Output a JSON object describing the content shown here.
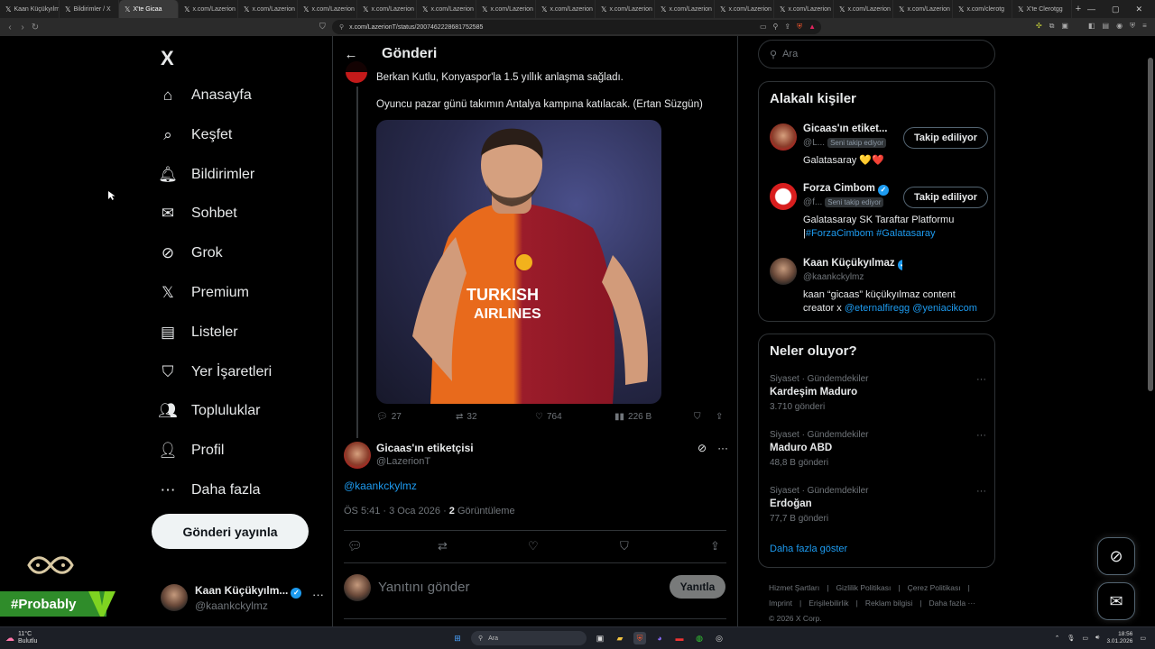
{
  "browser": {
    "tabs": [
      {
        "title": "Kaan Küçükyılm",
        "active": false
      },
      {
        "title": "Bildirimler / X",
        "active": false
      },
      {
        "title": "X'te Gicaa",
        "active": true
      },
      {
        "title": "x.com/Lazerion",
        "active": false
      },
      {
        "title": "x.com/Lazerion",
        "active": false
      },
      {
        "title": "x.com/Lazerion",
        "active": false
      },
      {
        "title": "x.com/Lazerion",
        "active": false
      },
      {
        "title": "x.com/Lazerion",
        "active": false
      },
      {
        "title": "x.com/Lazerion",
        "active": false
      },
      {
        "title": "x.com/Lazerion",
        "active": false
      },
      {
        "title": "x.com/Lazerion",
        "active": false
      },
      {
        "title": "x.com/Lazerion",
        "active": false
      },
      {
        "title": "x.com/Lazerion",
        "active": false
      },
      {
        "title": "x.com/Lazerion",
        "active": false
      },
      {
        "title": "x.com/Lazerion",
        "active": false
      },
      {
        "title": "x.com/Lazerion",
        "active": false
      },
      {
        "title": "x.com/clerotg",
        "active": false
      },
      {
        "title": "X'te Clerotgg",
        "active": false
      }
    ],
    "new_tab": "+",
    "window_controls": [
      "—",
      "▢",
      "✕"
    ],
    "url": "x.com/LazerionT/status/2007462228681752585"
  },
  "nav": {
    "logo": "X",
    "items": [
      {
        "label": "Anasayfa",
        "icon": "home-icon",
        "glyph": "⌂"
      },
      {
        "label": "Keşfet",
        "icon": "search-icon",
        "glyph": "⌕"
      },
      {
        "label": "Bildirimler",
        "icon": "bell-icon",
        "glyph": "🔔︎"
      },
      {
        "label": "Sohbet",
        "icon": "mail-icon",
        "glyph": "✉"
      },
      {
        "label": "Grok",
        "icon": "grok-icon",
        "glyph": "⊘"
      },
      {
        "label": "Premium",
        "icon": "x-premium-icon",
        "glyph": "𝕏"
      },
      {
        "label": "Listeler",
        "icon": "list-icon",
        "glyph": "▤"
      },
      {
        "label": "Yer İşaretleri",
        "icon": "bookmark-icon",
        "glyph": "⛉"
      },
      {
        "label": "Topluluklar",
        "icon": "communities-icon",
        "glyph": "👥︎"
      },
      {
        "label": "Profil",
        "icon": "profile-icon",
        "glyph": "👤︎"
      },
      {
        "label": "Daha fazla",
        "icon": "more-circle-icon",
        "glyph": "⋯"
      }
    ],
    "post_button": "Gönderi yayınla",
    "account": {
      "name": "Kaan Küçükyılm...",
      "handle": "@kaankckylmz",
      "more": "···"
    }
  },
  "watermark": {
    "tag": "#Probably"
  },
  "center": {
    "header_title": "Gönderi",
    "tweet": {
      "line1": "Berkan Kutlu, Konyaspor'la 1.5 yıllık anlaşma sağladı.",
      "line2": "Oyuncu pazar günü takımın Antalya kampına katılacak. (Ertan Süzgün)",
      "replies": "27",
      "retweets": "32",
      "likes": "764",
      "views": "226 B"
    },
    "reply": {
      "name": "Gicaas'ın etiketçisi",
      "handle": "@LazerionT",
      "mention": "@kaankckylmz",
      "time": "ÖS 5:41 · 3 Oca 2026 · ",
      "view_count": "2",
      "view_label": " Görüntüleme"
    },
    "compose": {
      "placeholder": "Yanıtını gönder",
      "button": "Yanıtla"
    }
  },
  "right": {
    "search_placeholder": "Ara",
    "people_title": "Alakalı kişiler",
    "people": [
      {
        "name": "Gicaas'ın etiket...",
        "handle": "@L...",
        "follows_you": "Seni takip ediyor",
        "button": "Takip ediliyor",
        "bio": "Galatasaray 💛❤️",
        "links": ""
      },
      {
        "name": "Forza Cimbom",
        "handle": "@f...",
        "follows_you": "Seni takip ediyor",
        "button": "Takip ediliyor",
        "bio": "Galatasaray SK Taraftar Platformu |",
        "links": "#ForzaCimbom #Galatasaray"
      },
      {
        "name": "Kaan Küçükyılmaz",
        "handle": "@kaankckylmz",
        "follows_you": "",
        "button": "",
        "bio": "kaan “gicaas” küçükyılmaz content creator x ",
        "links": "@eternalfiregg @yeniacikcom"
      }
    ],
    "trends_title": "Neler oluyor?",
    "trends": [
      {
        "category": "Siyaset · Gündemdekiler",
        "name": "Kardeşim Maduro",
        "count": "3.710 gönderi"
      },
      {
        "category": "Siyaset · Gündemdekiler",
        "name": "Maduro ABD",
        "count": "48,8 B gönderi"
      },
      {
        "category": "Siyaset · Gündemdekiler",
        "name": "Erdoğan",
        "count": "77,7 B gönderi"
      }
    ],
    "show_more": "Daha fazla göster",
    "footer": [
      "Hizmet Şartları",
      "|",
      "Gizlilik Politikası",
      "|",
      "Çerez Politikası",
      "|",
      "Imprint",
      "|",
      "Erişilebilirlik",
      "|",
      "Reklam bilgisi",
      "|",
      "Daha fazla ···",
      "© 2026 X Corp."
    ]
  },
  "taskbar": {
    "weather_temp": "11°C",
    "weather_desc": "Bulutlu",
    "search": "Ara",
    "time": "18:56",
    "date": "3.01.2026"
  },
  "colors": {
    "accent": "#1d9bf0",
    "background": "#000000",
    "border": "#2f3336",
    "muted": "#71767b",
    "watermark_green": "#2f8c2a"
  }
}
